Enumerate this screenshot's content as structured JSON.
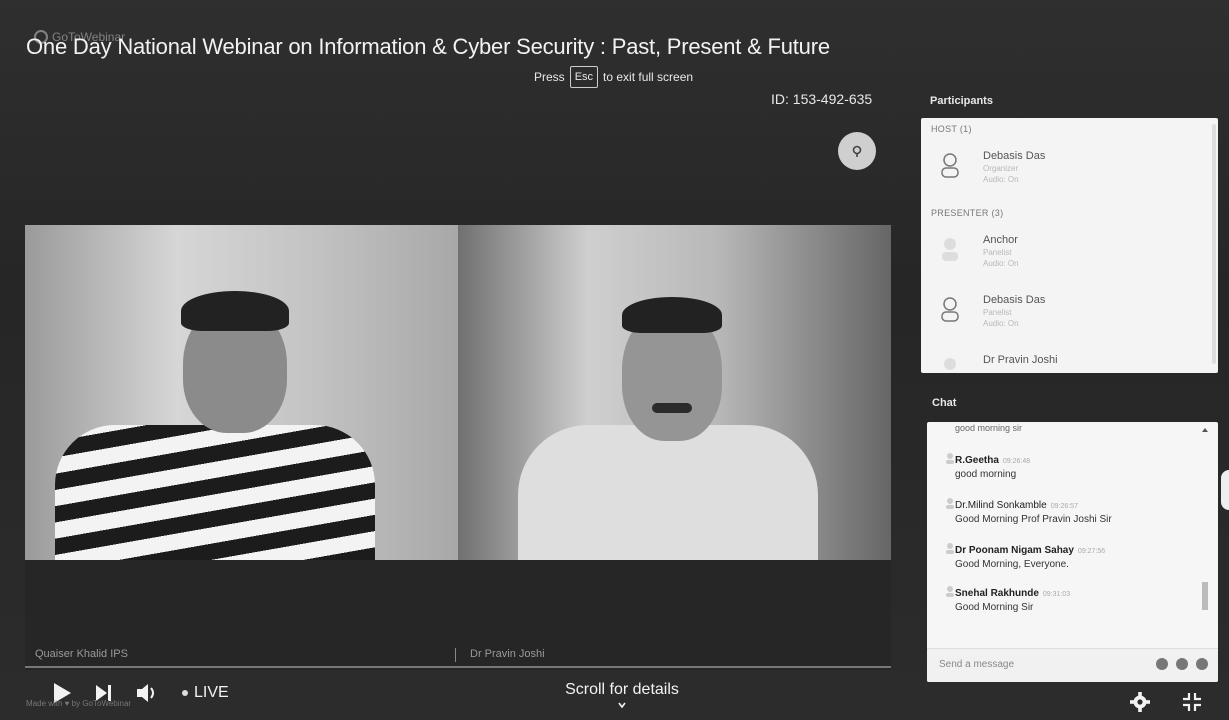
{
  "header": {
    "logo_label": "GoToWebinar",
    "title": "One Day National Webinar on Information & Cyber Security : Past, Present & Future",
    "esc_hint": {
      "press": "Press",
      "key": "Esc",
      "suffix": "to exit full screen"
    },
    "session_id": "ID: 153-492-635"
  },
  "video": {
    "tiles": [
      {
        "name": "Quaiser Khalid IPS"
      },
      {
        "name": "Dr Pravin Joshi"
      }
    ]
  },
  "player_controls": {
    "live_label": "LIVE",
    "scroll_hint": "Scroll for details",
    "watermark": "Made with ♥ by GoToWebinar"
  },
  "participants_panel": {
    "title": "Participants",
    "host_section": "HOST (1)",
    "presenter_section": "PRESENTER (3)",
    "host": [
      {
        "name": "Debasis Das",
        "sub": "Organizer",
        "sub2": "Audio: On"
      }
    ],
    "presenters": [
      {
        "name": "Anchor",
        "sub": "Panelist",
        "sub2": "Audio: On"
      },
      {
        "name": "Debasis Das",
        "sub": "Panelist",
        "sub2": "Audio: On"
      },
      {
        "name": "Dr Pravin Joshi"
      }
    ]
  },
  "chat_panel": {
    "title": "Chat",
    "top_message": "good morning sir",
    "messages": [
      {
        "name": "R.Geetha",
        "time": "09:26:48",
        "text": "good morning"
      },
      {
        "name": "Dr.Milind Sonkamble",
        "time": "09:26:57",
        "text": "Good Morning Prof Pravin Joshi Sir"
      },
      {
        "name": "Dr Poonam Nigam Sahay",
        "time": "09:27:56",
        "text": "Good Morning, Everyone."
      },
      {
        "name": "Snehal Rakhunde",
        "time": "09:31:03",
        "text": "Good Morning Sir"
      }
    ],
    "input_placeholder": "Send a message"
  }
}
